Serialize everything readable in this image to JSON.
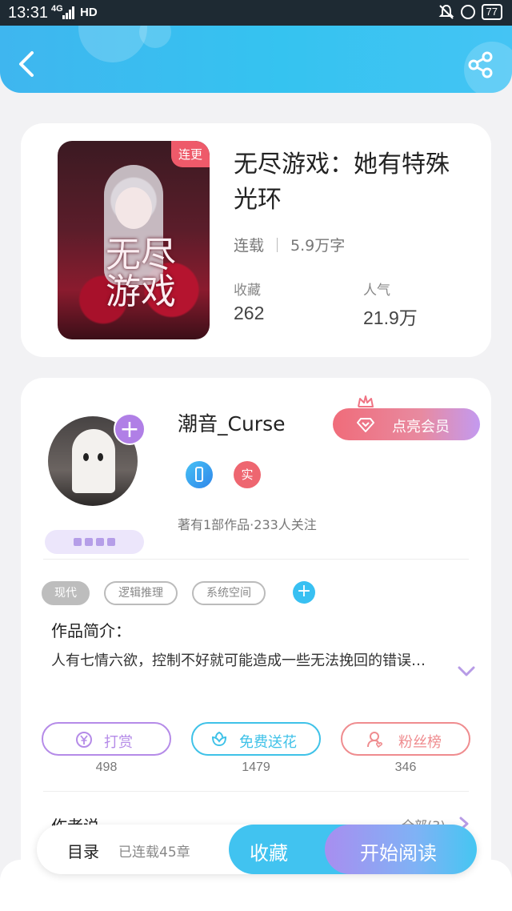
{
  "status_bar": {
    "time": "13:31",
    "signal": "4G",
    "hd": "HD",
    "battery": "77"
  },
  "book": {
    "status_badge": "连更",
    "cover_title": "无尽游戏",
    "title": "无尽游戏：她有特殊光环",
    "serial_status": "连载",
    "word_count": "5.9万字",
    "favorites_label": "收藏",
    "favorites_value": "262",
    "popularity_label": "人气",
    "popularity_value": "21.9万"
  },
  "author": {
    "name": "潮音_Curse",
    "vip_label": "点亮会员",
    "real_badge": "实",
    "stats": "著有1部作品·233人关注",
    "follow_symbol": "+"
  },
  "tags": [
    "现代",
    "逻辑推理",
    "系统空间"
  ],
  "tag_add_symbol": "+",
  "intro": {
    "label": "作品简介：",
    "text": "人有七情六欲，控制不好就可能造成一些无法挽回的错误…"
  },
  "actions": [
    {
      "label": "打赏",
      "count": "498",
      "color": "#b58be8"
    },
    {
      "label": "免费送花",
      "count": "1479",
      "color": "#3fc2e8"
    },
    {
      "label": "粉丝榜",
      "count": "346",
      "color": "#ef8c8f"
    }
  ],
  "author_say": {
    "label": "作者说",
    "all_link": "全部(3)"
  },
  "bottom_bar": {
    "toc_label": "目录",
    "toc_info": "已连载45章",
    "favorite_label": "收藏",
    "read_label": "开始阅读"
  },
  "colors": {
    "accent": "#41c3f0",
    "vip": "#f06c7a",
    "purple": "#b07fe6"
  }
}
